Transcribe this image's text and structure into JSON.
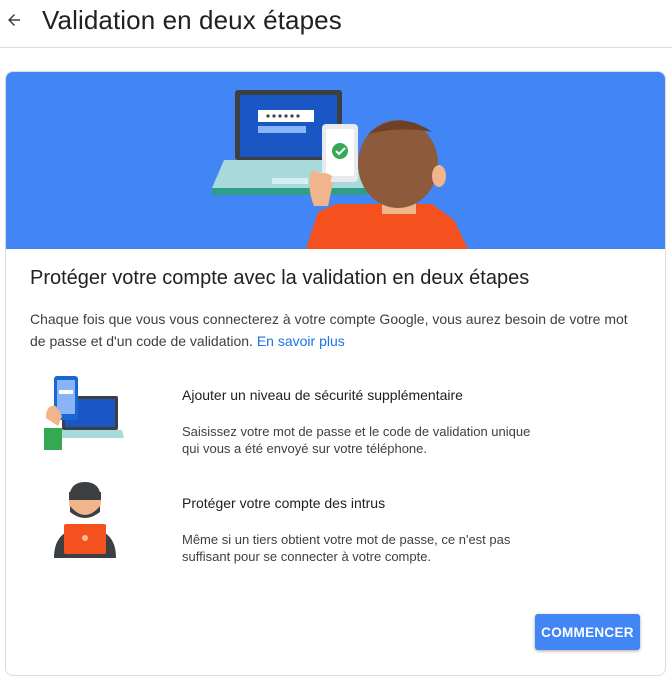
{
  "header": {
    "back_icon": "arrow-back-icon",
    "title": "Validation en deux étapes"
  },
  "card": {
    "banner_icon": "laptop-phone-person-illustration",
    "title": "Protéger votre compte avec la validation en deux étapes",
    "intro": "Chaque fois que vous vous connecterez à votre compte Google, vous aurez besoin de votre mot de passe et d'un code de validation.",
    "learn_more_link": "En savoir plus",
    "features": [
      {
        "icon": "phone-laptop-security-illustration",
        "title": "Ajouter un niveau de sécurité supplémentaire",
        "description": "Saisissez votre mot de passe et le code de validation unique qui vous a été envoyé sur votre téléphone."
      },
      {
        "icon": "masked-intruder-illustration",
        "title": "Protéger votre compte des intrus",
        "description": "Même si un tiers obtient votre mot de passe, ce n'est pas suffisant pour se connecter à votre compte."
      }
    ],
    "start_button": "COMMENCER"
  },
  "colors": {
    "brand_blue": "#4285f4",
    "link_blue": "#1a73e8",
    "text_primary": "#202124",
    "text_secondary": "#3c4043",
    "divider": "#dadce0"
  }
}
